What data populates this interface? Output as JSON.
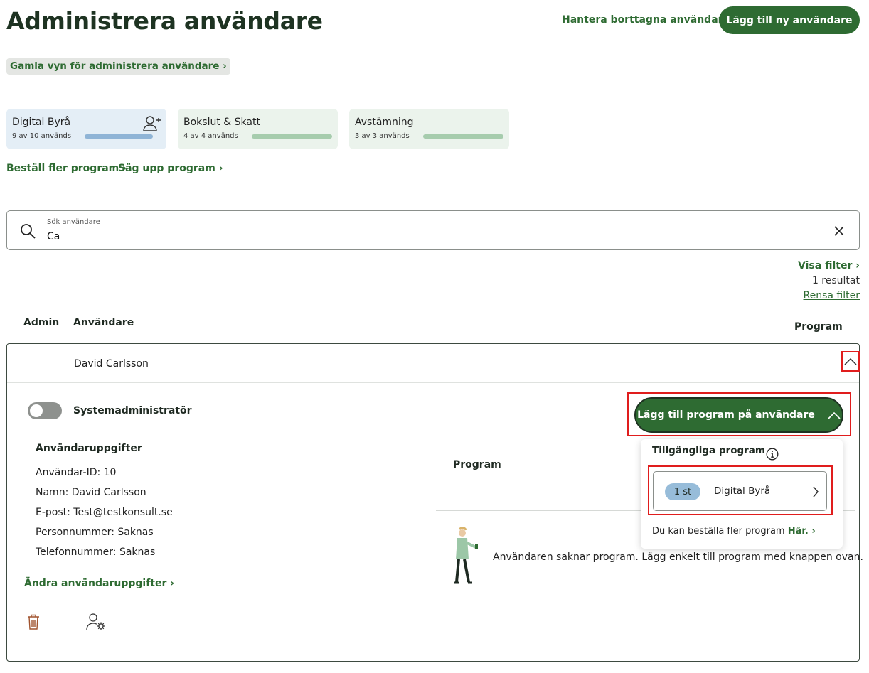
{
  "header": {
    "title": "Administrera användare",
    "manage_deleted_label": "Hantera borttagna användare ›",
    "add_user_label": "Lägg till ny användare",
    "old_view_label": "Gamla vyn för administrera användare ›"
  },
  "programs": [
    {
      "name": "Digital Byrå",
      "usage": "9 av 10 används",
      "used": 9,
      "total": 10,
      "bar_color": "#8fb4d6",
      "icon": "add-user-icon"
    },
    {
      "name": "Bokslut & Skatt",
      "usage": "4 av 4 används",
      "used": 4,
      "total": 4,
      "bar_color": "#a6ccad"
    },
    {
      "name": "Avstämning",
      "usage": "3 av 3 används",
      "used": 3,
      "total": 3,
      "bar_color": "#a6ccad"
    }
  ],
  "program_links": {
    "order_more": "Beställ fler program ›",
    "cancel": "Säg upp program ›"
  },
  "search": {
    "label": "Sök användare",
    "value": "Ca"
  },
  "filters": {
    "show_filter": "Visa filter ›",
    "result_count": "1 resultat",
    "clear_filter": "Rensa filter"
  },
  "table": {
    "columns": {
      "admin": "Admin",
      "user": "Användare",
      "program": "Program"
    }
  },
  "user": {
    "name": "David Carlsson",
    "admin_toggle_label": "Systemadministratör",
    "admin_enabled": false,
    "details_title": "Användaruppgifter",
    "details": [
      "Användar-ID: 10",
      "Namn: David Carlsson",
      "E-post: Test@testkonsult.se",
      "Personnummer: Saknas",
      "Telefonnummer: Saknas"
    ],
    "edit_link": "Ändra användaruppgifter ›"
  },
  "program_section": {
    "add_program_label": "Lägg till program på användare",
    "heading": "Program",
    "empty_message": "Användaren saknar program. Lägg enkelt till program med knappen ovan."
  },
  "dropdown": {
    "title": "Tillgängliga program",
    "items": [
      {
        "count": "1 st",
        "name": "Digital Byrå"
      }
    ],
    "footer_text": "Du kan beställa fler program ",
    "footer_link": "Här. ›"
  },
  "colors": {
    "brand_green": "#2e6b32",
    "highlight_red": "#e01d1d"
  }
}
